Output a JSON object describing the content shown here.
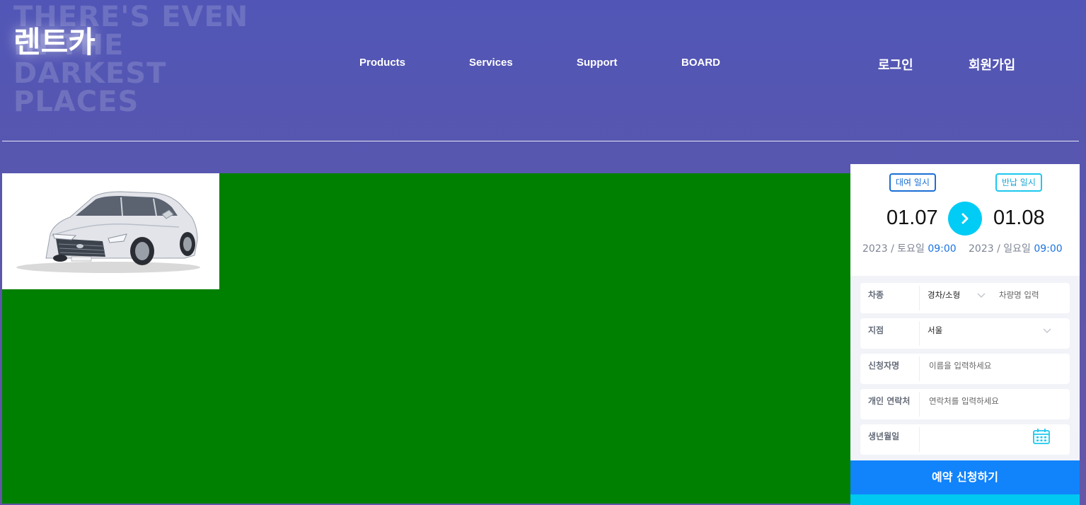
{
  "header": {
    "background_text": "THERE'S EVEN IN THE DARKEST PLACES",
    "logo": "렌트카",
    "nav": [
      "Products",
      "Services",
      "Support",
      "BOARD"
    ],
    "login": "로그인",
    "signup": "회원가입"
  },
  "colors": {
    "header_gradient_top": "#5156b6",
    "header_gradient_bottom": "#6457a8",
    "main_area": "#008000",
    "accent_blue": "#1183fb",
    "accent_cyan": "#00ccf5"
  },
  "vehicle": {
    "image": "white sedan"
  },
  "reservation": {
    "rental_label": "대여 일시",
    "return_label": "반납 일시",
    "rental_date": "01.07",
    "return_date": "01.08",
    "rental_year_day": "2023 / 토요일",
    "rental_time": "09:00",
    "return_year_day": "2023 / 일요일",
    "return_time": "09:00",
    "arrow_icon": "chevron-right-icon",
    "fields": {
      "car_type": {
        "label": "차종",
        "value": "경차/소형",
        "placeholder": "차량명 입력"
      },
      "branch": {
        "label": "지점",
        "value": "서울"
      },
      "applicant": {
        "label": "신청자명",
        "placeholder": "이름을 입력하세요"
      },
      "contact": {
        "label": "개인 연락처",
        "placeholder": "연락처를 입력하세요"
      },
      "birth": {
        "label": "생년월일",
        "icon": "calendar-icon"
      }
    },
    "submit": "예약 신청하기"
  }
}
